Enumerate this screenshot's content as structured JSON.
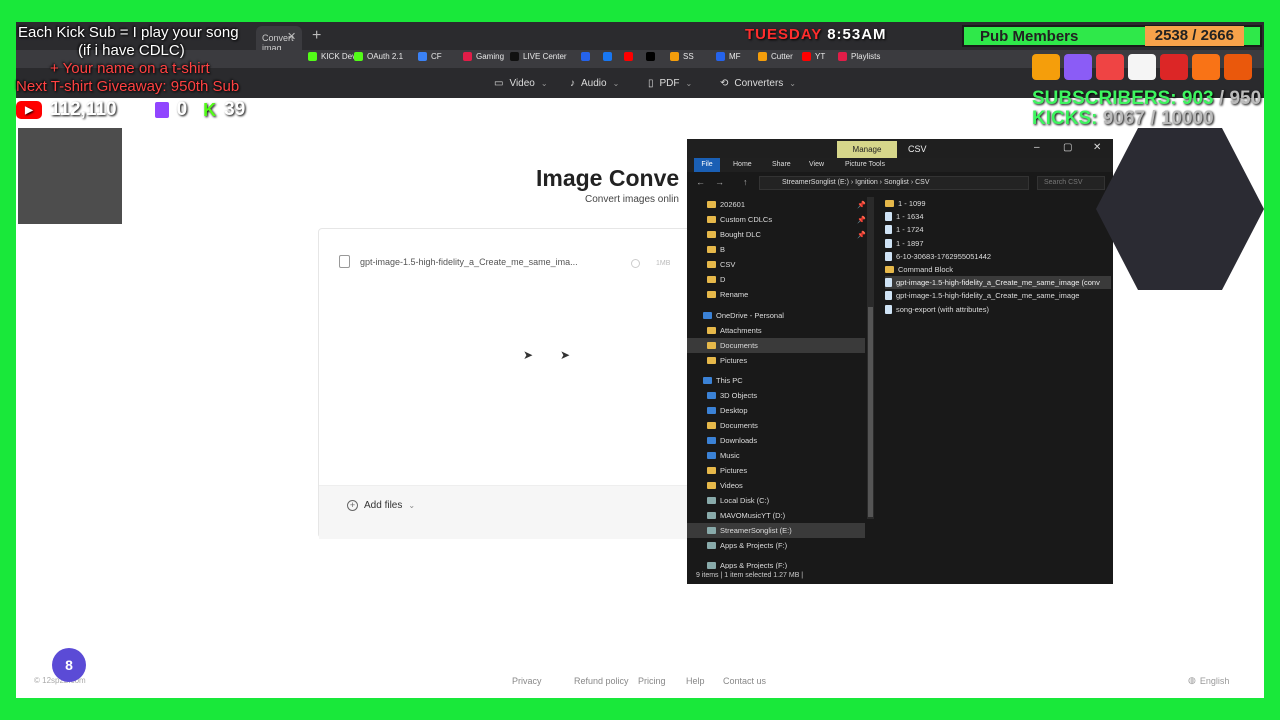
{
  "browser": {
    "tab_label": "Convert imag",
    "bookmarks": [
      {
        "label": "KICK Dev",
        "color": "#53fc18"
      },
      {
        "label": "OAuth 2.1",
        "color": "#53fc18"
      },
      {
        "label": "CF",
        "color": "#3b82f6"
      },
      {
        "label": "Gaming",
        "color": "#e11d48"
      },
      {
        "label": "LIVE Center",
        "color": "#111111"
      },
      {
        "label": "",
        "color": "#2563eb"
      },
      {
        "label": "",
        "color": "#1877f2"
      },
      {
        "label": "",
        "color": "#ff0000"
      },
      {
        "label": "",
        "color": "#000000"
      },
      {
        "label": "SS",
        "color": "#f59e0b"
      },
      {
        "label": "MF",
        "color": "#2563eb"
      },
      {
        "label": "Cutter",
        "color": "#f59e0b"
      },
      {
        "label": "YT",
        "color": "#ff0000"
      },
      {
        "label": "Playlists",
        "color": "#e11d48"
      }
    ]
  },
  "site": {
    "nav": [
      {
        "label": "Video",
        "icon": "video-icon"
      },
      {
        "label": "Audio",
        "icon": "music-icon"
      },
      {
        "label": "PDF",
        "icon": "pdf-icon"
      },
      {
        "label": "Converters",
        "icon": "refresh-icon"
      }
    ],
    "title": "Image Conve",
    "subtitle": "Convert images onlin",
    "file_name": "gpt-image-1.5-high-fidelity_a_Create_me_same_ima...",
    "file_size": "1MB",
    "add_files_label": "Add files",
    "footer": {
      "copyright": "© 12sp2b.com",
      "links": [
        "Privacy",
        "Refund policy",
        "Pricing",
        "Help",
        "Contact us"
      ],
      "language": "English"
    }
  },
  "explorer": {
    "title": "CSV",
    "manage_label": "Manage",
    "ribbon_tabs": [
      "File",
      "Home",
      "Share",
      "View",
      "Picture Tools"
    ],
    "path": [
      "StreamerSonglist (E:)",
      "Ignition",
      "Songlist",
      "CSV"
    ],
    "search_placeholder": "Search CSV",
    "nav_items": [
      {
        "label": "202601",
        "type": "folder",
        "pinned": true
      },
      {
        "label": "Custom CDLCs",
        "type": "folder",
        "pinned": true
      },
      {
        "label": "Bought DLC",
        "type": "folder",
        "pinned": true
      },
      {
        "label": "B",
        "type": "folder"
      },
      {
        "label": "CSV",
        "type": "folder"
      },
      {
        "label": "D",
        "type": "folder"
      },
      {
        "label": "Rename",
        "type": "folder"
      },
      {
        "label": "OneDrive - Personal",
        "type": "cloud"
      },
      {
        "label": "Attachments",
        "type": "folder"
      },
      {
        "label": "Documents",
        "type": "folder",
        "selected": true
      },
      {
        "label": "Pictures",
        "type": "folder"
      },
      {
        "label": "This PC",
        "type": "pc"
      },
      {
        "label": "3D Objects",
        "type": "blue"
      },
      {
        "label": "Desktop",
        "type": "blue"
      },
      {
        "label": "Documents",
        "type": "folder"
      },
      {
        "label": "Downloads",
        "type": "blue"
      },
      {
        "label": "Music",
        "type": "blue"
      },
      {
        "label": "Pictures",
        "type": "folder"
      },
      {
        "label": "Videos",
        "type": "folder"
      },
      {
        "label": "Local Disk (C:)",
        "type": "drive"
      },
      {
        "label": "MAVOMusicYT (D:)",
        "type": "drive"
      },
      {
        "label": "StreamerSonglist (E:)",
        "type": "drive",
        "selected": true
      },
      {
        "label": "Apps & Projects (F:)",
        "type": "drive"
      },
      {
        "label": "Apps & Projects (F:)",
        "type": "drive"
      }
    ],
    "files": [
      {
        "label": "1 - 1099",
        "type": "folder"
      },
      {
        "label": "1 - 1634",
        "type": "doc"
      },
      {
        "label": "1 - 1724",
        "type": "doc"
      },
      {
        "label": "1 - 1897",
        "type": "doc"
      },
      {
        "label": "6-10-30683-1762955051442",
        "type": "doc"
      },
      {
        "label": "Command Block",
        "type": "folder"
      },
      {
        "label": "gpt-image-1.5-high-fidelity_a_Create_me_same_image (conv",
        "type": "doc",
        "selected": true
      },
      {
        "label": "gpt-image-1.5-high-fidelity_a_Create_me_same_image",
        "type": "doc"
      },
      {
        "label": "song-export (with attributes)",
        "type": "doc"
      }
    ],
    "status": "9 items  |  1 item selected  1.27 MB  |"
  },
  "overlay": {
    "kick_sub_line1": "Each Kick Sub = I play your song",
    "kick_sub_line2": "(if i have CDLC)",
    "kick_sub_line3": "+ Your name on a t-shirt",
    "giveaway": "Next T-shirt Giveaway: 950th Sub",
    "youtube_count": "112,110",
    "twitch_count": "0",
    "kick_count": "39",
    "day": "TUESDAY",
    "time": "8:53AM",
    "pub_label": "Pub Members",
    "pub_count": "2538 / 2666",
    "subscribers_label": "SUBSCRIBERS:",
    "subscribers_value": "903",
    "subscribers_goal": "/ 950",
    "kicks_label": "KICKS:",
    "kicks_value": "9067",
    "kicks_goal": "/ 10000"
  }
}
